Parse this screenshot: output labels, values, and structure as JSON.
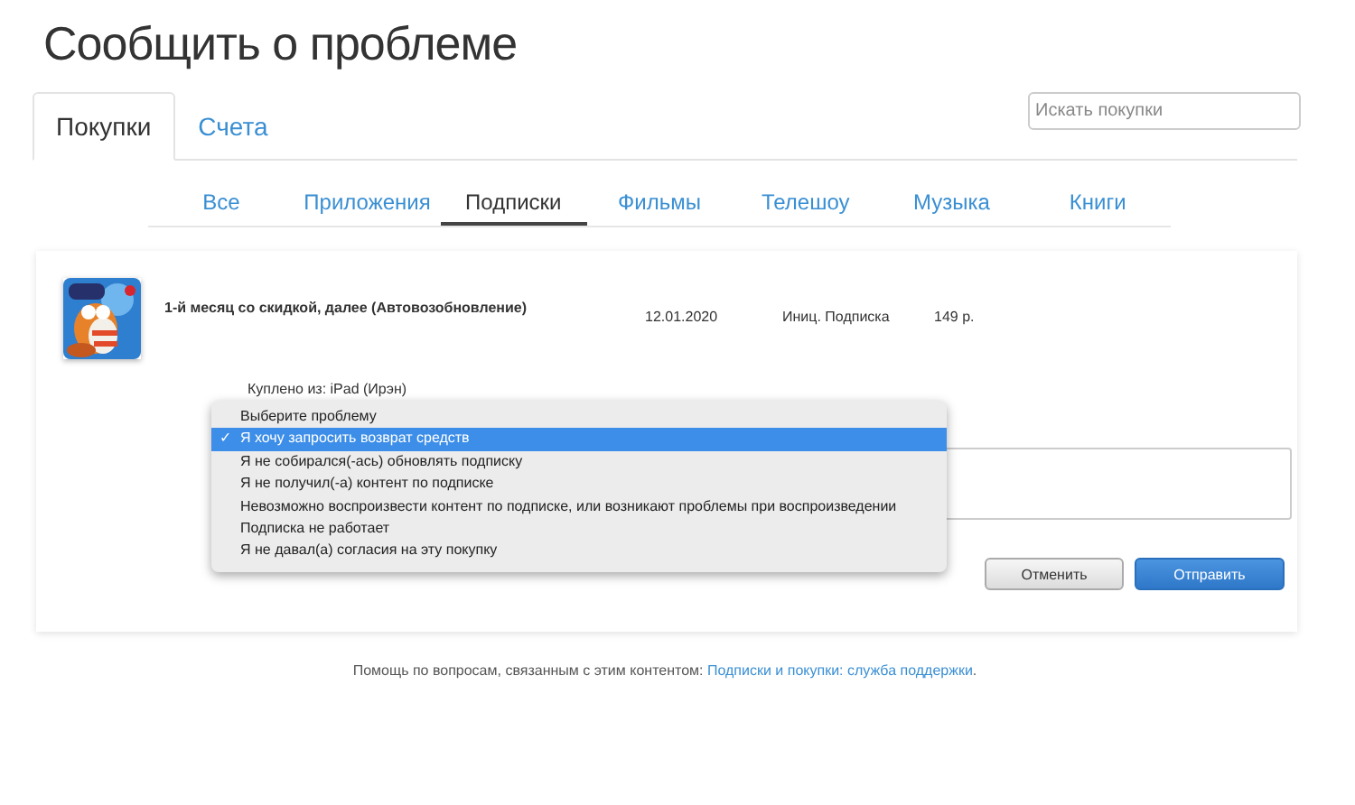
{
  "page_title": "Сообщить о проблеме",
  "tabs": [
    {
      "label": "Покупки",
      "selected": true
    },
    {
      "label": "Счета",
      "selected": false
    }
  ],
  "search": {
    "placeholder": "Искать покупки"
  },
  "categories": [
    {
      "label": "Все",
      "selected": false
    },
    {
      "label": "Приложения",
      "selected": false
    },
    {
      "label": "Подписки",
      "selected": true
    },
    {
      "label": "Фильмы",
      "selected": false
    },
    {
      "label": "Телешоу",
      "selected": false
    },
    {
      "label": "Музыка",
      "selected": false
    },
    {
      "label": "Книги",
      "selected": false
    }
  ],
  "purchase": {
    "title": "1-й месяц со скидкой, далее (Автовозобновление)",
    "date": "12.01.2020",
    "type": "Иниц. Подписка",
    "price": "149 р.",
    "purchased_from": "Куплено из: iPad (Ирэн)"
  },
  "problem_menu": [
    {
      "label": "Выберите проблему",
      "selected": false
    },
    {
      "label": "Я хочу запросить возврат средств",
      "selected": true
    },
    {
      "label": "Я не собирался(-ась) обновлять подписку",
      "selected": false
    },
    {
      "label": "Я не получил(-а) контент по подписке",
      "selected": false
    },
    {
      "label": "Невозможно воспроизвести контент по подписке, или возникают проблемы при воспроизведении",
      "selected": false
    },
    {
      "label": "Подписка не работает",
      "selected": false
    },
    {
      "label": "Я не давал(а) согласия на эту покупку",
      "selected": false
    }
  ],
  "check_mark": "✓",
  "buttons": [
    {
      "label": "Отменить",
      "kind": "secondary"
    },
    {
      "label": "Отправить",
      "kind": "primary"
    }
  ],
  "footer": {
    "text": "Помощь по вопросам, связанным с этим контентом: ",
    "link": "Подписки и покупки: служба поддержки",
    "end": "."
  }
}
